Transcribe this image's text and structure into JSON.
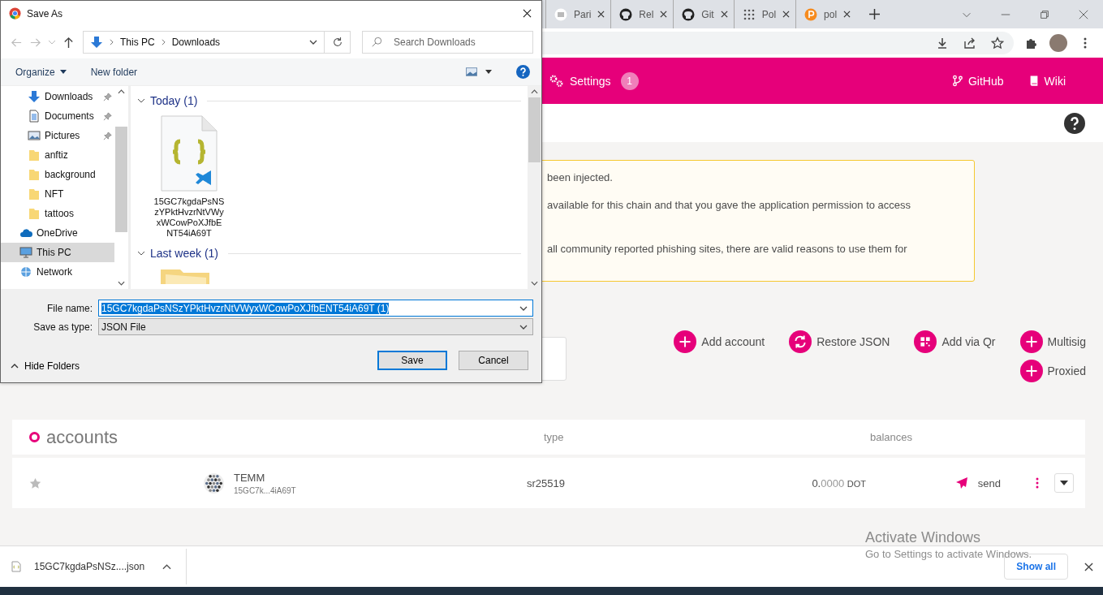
{
  "browser": {
    "tabs": [
      {
        "title": "Pari",
        "kind": "doc"
      },
      {
        "title": "Rel",
        "kind": "github"
      },
      {
        "title": "Git",
        "kind": "github"
      },
      {
        "title": "Pol",
        "kind": "dots"
      },
      {
        "title": "pol",
        "kind": "coin"
      }
    ]
  },
  "app_header": {
    "settings": "Settings",
    "settings_badge": "1",
    "github": "GitHub",
    "wiki": "Wiki"
  },
  "warning": {
    "lines": [
      "been injected.",
      "available for this chain and that you gave the application permission to access",
      "all community reported phishing sites, there are valid reasons to use them for"
    ]
  },
  "actions": [
    {
      "label": "Add account",
      "kind": "plus"
    },
    {
      "label": "Restore JSON",
      "kind": "sync"
    },
    {
      "label": "Add via Qr",
      "kind": "qr"
    },
    {
      "label": "Multisig",
      "kind": "plus"
    },
    {
      "label": "Proxied",
      "kind": "plus"
    }
  ],
  "accounts": {
    "title": "accounts",
    "columns": [
      "type",
      "balances"
    ],
    "rows": [
      {
        "name": "TEMM",
        "address": "15GC7k...4iA69T",
        "type": "sr25519",
        "balance_int": "0.",
        "balance_dec": "0000",
        "unit": "DOT",
        "send": "send"
      }
    ]
  },
  "download_bar": {
    "file": "15GC7kgdaPsNSz....json",
    "show_all": "Show all"
  },
  "os_notice": {
    "title": "Activate Windows",
    "text": "Go to Settings to activate Windows."
  },
  "dialog": {
    "title": "Save As",
    "path": [
      "This PC",
      "Downloads"
    ],
    "search_placeholder": "Search Downloads",
    "organize": "Organize",
    "new_folder": "New folder",
    "nav": [
      {
        "label": "Downloads",
        "kind": "download",
        "pinned": true,
        "selected": false
      },
      {
        "label": "Documents",
        "kind": "document",
        "pinned": true,
        "selected": false
      },
      {
        "label": "Pictures",
        "kind": "picture",
        "pinned": true,
        "selected": false
      },
      {
        "label": "anftiz",
        "kind": "folder",
        "pinned": false,
        "selected": false
      },
      {
        "label": "background",
        "kind": "folder",
        "pinned": false,
        "selected": false
      },
      {
        "label": "NFT",
        "kind": "folder",
        "pinned": false,
        "selected": false
      },
      {
        "label": "tattoos",
        "kind": "folder",
        "pinned": false,
        "selected": false
      },
      {
        "label": "OneDrive",
        "kind": "cloud",
        "pinned": false,
        "selected": false
      },
      {
        "label": "This PC",
        "kind": "pc",
        "pinned": false,
        "selected": true
      },
      {
        "label": "Network",
        "kind": "network",
        "pinned": false,
        "selected": false
      }
    ],
    "groups": [
      {
        "title": "Today (1)",
        "expanded": true,
        "files": [
          {
            "name": "15GC7kgdaPsNSzYPktHvzrNtVWyxWCowPoXJfbENT54iA69T",
            "kind": "json"
          }
        ]
      },
      {
        "title": "Last week (1)",
        "expanded": true,
        "files": [
          {
            "kind": "folder"
          }
        ]
      }
    ],
    "file_name_label": "File name:",
    "file_name": "15GC7kgdaPsNSzYPktHvzrNtVWyxWCowPoXJfbENT54iA69T (1)",
    "type_label": "Save as type:",
    "type": "JSON File",
    "hide_folders": "Hide Folders",
    "buttons": [
      {
        "label": "Save",
        "kind": "default"
      },
      {
        "label": "Cancel",
        "kind": "normal"
      }
    ]
  }
}
